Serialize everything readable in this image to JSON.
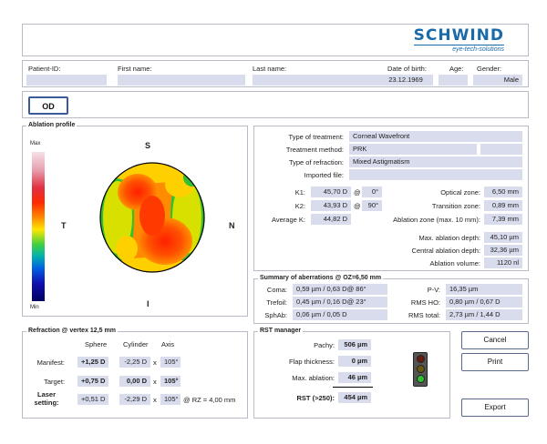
{
  "logo": {
    "brand": "SCHWIND",
    "tagline": "eye-tech-solutions"
  },
  "patient": {
    "id_label": "Patient-ID:",
    "id_value": "",
    "first_label": "First name:",
    "first_value": "",
    "last_label": "Last name:",
    "last_value": "",
    "dob_label": "Date of birth:",
    "dob_value": "23.12.1969",
    "age_label": "Age:",
    "age_value": "",
    "gender_label": "Gender:",
    "gender_value": "Male"
  },
  "eye_button": "OD",
  "ablation": {
    "title": "Ablation profile",
    "max": "Max",
    "min": "Min",
    "s": "S",
    "t": "T",
    "n": "N",
    "i": "I"
  },
  "treatment": {
    "type_label": "Type of treatment:",
    "type_value": "Corneal Wavefront",
    "method_label": "Treatment method:",
    "method_value": "PRK",
    "refraction_label": "Type of refraction:",
    "refraction_value": "Mixed Astigmatism",
    "imported_label": "Imported file:",
    "imported_value": "",
    "k1_label": "K1:",
    "k1_value": "45,70 D",
    "k1_at": "@",
    "k1_axis": "0°",
    "k2_label": "K2:",
    "k2_value": "43,93 D",
    "k2_at": "@",
    "k2_axis": "90°",
    "avgk_label": "Average K:",
    "avgk_value": "44,82 D",
    "optical_label": "Optical zone:",
    "optical_value": "6,50 mm",
    "transition_label": "Transition zone:",
    "transition_value": "0,89 mm",
    "ablzone_label": "Ablation zone (max. 10 mm):",
    "ablzone_value": "7,39 mm",
    "maxdepth_label": "Max. ablation depth:",
    "maxdepth_value": "45,10 µm",
    "centraldepth_label": "Central ablation depth:",
    "centraldepth_value": "32,36 µm",
    "volume_label": "Ablation volume:",
    "volume_value": "1120 nl"
  },
  "aberrations": {
    "title": "Summary of aberrations @ OZ=6,50 mm",
    "coma_label": "Coma:",
    "coma_value": "0,59 µm / 0,63 D@ 86°",
    "trefoil_label": "Trefoil:",
    "trefoil_value": "0,45 µm / 0,16 D@ 23°",
    "sphab_label": "SphAb:",
    "sphab_value": "0,06 µm / 0,05 D",
    "pv_label": "P-V:",
    "pv_value": "16,35 µm",
    "rmsho_label": "RMS HO:",
    "rmsho_value": "0,80 µm / 0,67 D",
    "rmstotal_label": "RMS total:",
    "rmstotal_value": "2,73 µm / 1,44 D"
  },
  "refraction": {
    "title": "Refraction @ vertex 12,5 mm",
    "col_sphere": "Sphere",
    "col_cylinder": "Cylinder",
    "col_axis": "Axis",
    "manifest_label": "Manifest:",
    "manifest_sphere": "+1,25 D",
    "manifest_cyl": "-2,25 D",
    "manifest_axis": "105°",
    "target_label": "Target:",
    "target_sphere": "+0,75 D",
    "target_cyl": "0,00 D",
    "target_axis": "105°",
    "laser_label1": "Laser",
    "laser_label2": "setting:",
    "laser_sphere": "+0,51 D",
    "laser_cyl": "-2,29 D",
    "laser_axis": "105°",
    "x": "x",
    "rz_note": "@ RZ = 4,00 mm"
  },
  "rst": {
    "title": "RST manager",
    "pachy_label": "Pachy:",
    "pachy_value": "506 µm",
    "flap_label": "Flap thickness:",
    "flap_value": "0 µm",
    "maxabl_label": "Max. ablation:",
    "maxabl_value": "46 µm",
    "rst_label": "RST (>250):",
    "rst_value": "454 µm"
  },
  "buttons": {
    "cancel": "Cancel",
    "print": "Print",
    "export": "Export"
  },
  "colors": {
    "field_bg": "#d8dcec",
    "brand_blue": "#1a6aa8",
    "traffic_green": "#2fc12f"
  }
}
